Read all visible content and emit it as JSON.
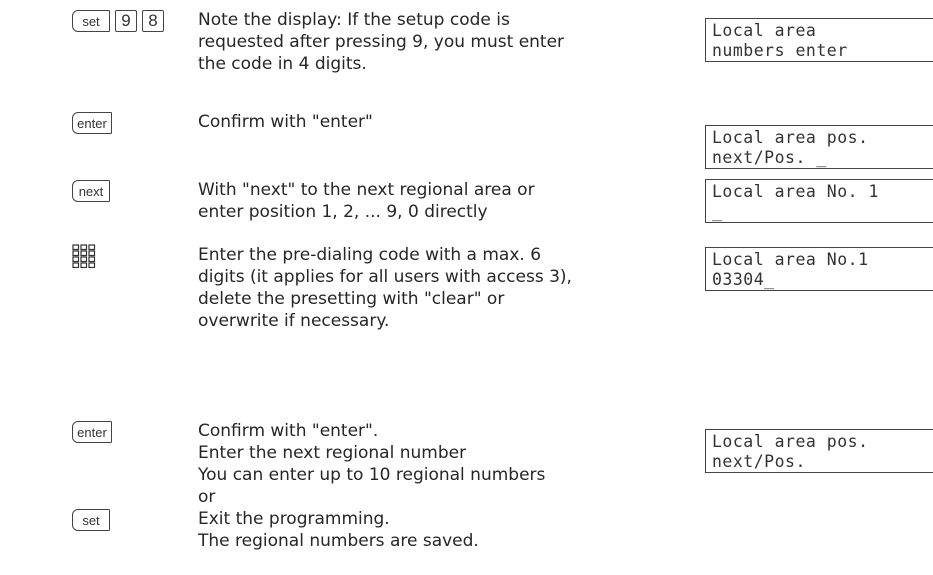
{
  "steps": [
    {
      "keys": [
        "set",
        "9",
        "8"
      ],
      "lines": [
        "Note the display: If the setup code is",
        "requested after pressing 9, you must enter",
        "the code in 4 digits."
      ],
      "display": [
        "Local area",
        "numbers enter"
      ]
    },
    {
      "keys": [
        "enter"
      ],
      "lines": [
        "Confirm with \"enter\""
      ],
      "display": [
        "Local area pos.",
        "next/Pos. _"
      ]
    },
    {
      "keys": [
        "next"
      ],
      "lines": [
        "With \"next\" to the next regional area or",
        "enter position 1, 2, ... 9, 0 directly"
      ],
      "display": [
        "Local area No. 1",
        "_"
      ]
    },
    {
      "keys": [
        "keypad-icon"
      ],
      "lines": [
        "Enter the pre-dialing code with a max. 6",
        "digits (it applies for all users with access 3),",
        "delete the presetting with \"clear\" or",
        "overwrite if necessary."
      ],
      "display": [
        "Local area No.1",
        "03304_"
      ]
    },
    {
      "keys": [
        "enter"
      ],
      "lines": [
        "Confirm with \"enter\".",
        "Enter the next regional number",
        "You can enter up to 10 regional numbers",
        "or"
      ],
      "display": [
        "Local area pos.",
        "next/Pos."
      ]
    },
    {
      "keys": [
        "set"
      ],
      "lines": [
        "Exit the programming.",
        "The regional numbers are saved."
      ],
      "display": []
    }
  ]
}
